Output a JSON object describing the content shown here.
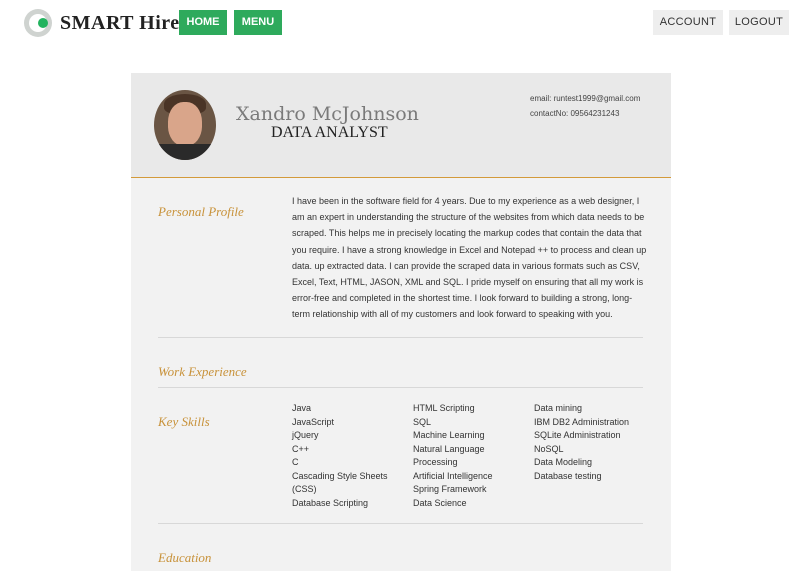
{
  "brand": {
    "name": "SM͠RT Hire",
    "display": "SMART Hire"
  },
  "nav": {
    "home": "HOME",
    "menu": "MENU",
    "account": "ACCOUNT",
    "logout": "LOGOUT"
  },
  "profile": {
    "name": "Xandro McJohnson",
    "title": "DATA ANALYST",
    "email": "email: runtest1999@gmail.com",
    "contact": "contactNo: 09564231243"
  },
  "sections": {
    "personal_profile": "Personal Profile",
    "work_experience": "Work Experience",
    "key_skills": "Key Skills",
    "education": "Education"
  },
  "personal_profile_text": "I have been in the software field for 4 years. Due to my experience as a web designer, I am an expert in understanding the structure of the websites from which data needs to be scraped. This helps me in precisely locating the markup codes that contain the data that you require. I have a strong knowledge in Excel and Notepad ++ to process and clean up data. up extracted data. I can provide the scraped data in various formats such as CSV, Excel, Text, HTML, JASON, XML and SQL. I pride myself on ensuring that all my work is error-free and completed in the shortest time. I look forward to building a strong, long-term relationship with all of my customers and look forward to speaking with you.",
  "skills": {
    "col1": [
      "Java",
      "JavaScript",
      "jQuery",
      "C++",
      "C",
      "Cascading Style Sheets",
      "(CSS)",
      "Database Scripting"
    ],
    "col2": [
      "HTML Scripting",
      "SQL",
      "Machine Learning",
      "Natural Language",
      "Processing",
      "Artificial Intelligence",
      "Spring Framework",
      "Data Science"
    ],
    "col3": [
      "Data mining",
      "IBM DB2 Administration",
      "SQLite Administration",
      "NoSQL",
      "Data Modeling",
      "Database testing"
    ]
  },
  "colors": {
    "accent_green": "#2eaa5c",
    "section_label": "#c8923a"
  }
}
